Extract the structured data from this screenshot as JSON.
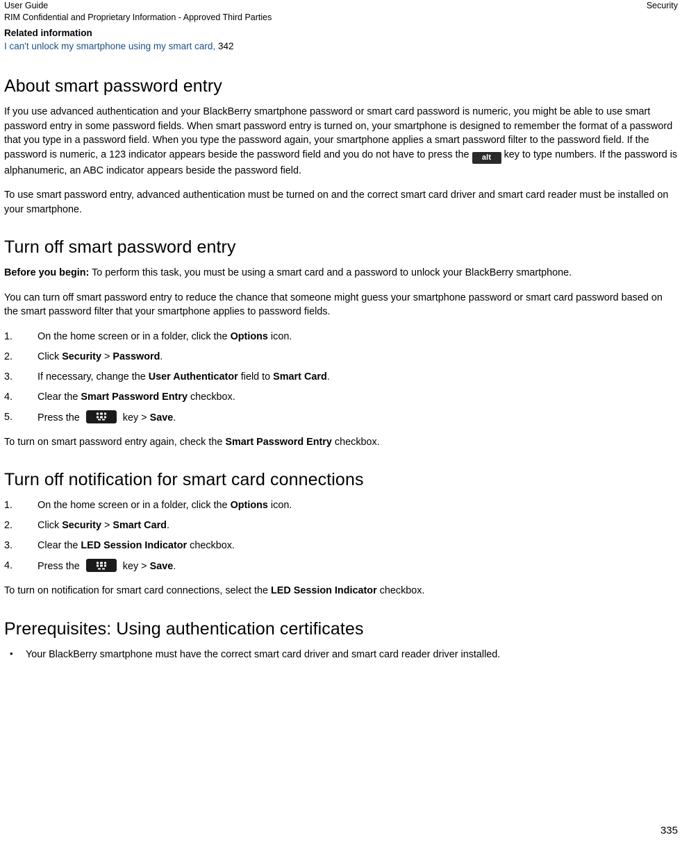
{
  "header": {
    "left_line1": "User Guide",
    "left_line2": "RIM Confidential and Proprietary Information - Approved Third Parties",
    "right_line1": "Security"
  },
  "related": {
    "title": "Related information",
    "link_text": "I can't unlock my smartphone using my smart card,",
    "page_ref": " 342"
  },
  "sections": {
    "smart_password_entry": {
      "heading": "About smart password entry",
      "para1_a": "If you use advanced authentication and your BlackBerry smartphone password or smart card password is numeric, you might be able to use smart password entry in some password fields. When smart password entry is turned on, your smartphone is designed to remember the format of a password that you type in a password field. When you type the password again, your smartphone applies a smart password filter to the password field. If the password is numeric, a 123 indicator appears beside the password field and you do not have to press the",
      "alt_key": "alt",
      "para1_b": "key to type numbers. If the password is alphanumeric, an ABC indicator appears beside the password field.",
      "para2": "To use smart password entry, advanced authentication must be turned on and the correct smart card driver and smart card reader must be installed on your smartphone."
    },
    "turn_off_smart_password": {
      "heading": "Turn off smart password entry",
      "before_label": "Before you begin:",
      "before_text": " To perform this task, you must be using a smart card and a password to unlock your BlackBerry smartphone.",
      "para": "You can turn off smart password entry to reduce the chance that someone might guess your smartphone password or smart card password based on the smart password filter that your smartphone applies to password fields.",
      "steps": [
        {
          "num": "1.",
          "parts": [
            {
              "t": "On the home screen or in a folder, click the ",
              "b": false
            },
            {
              "t": "Options",
              "b": true
            },
            {
              "t": " icon.",
              "b": false
            }
          ]
        },
        {
          "num": "2.",
          "parts": [
            {
              "t": "Click ",
              "b": false
            },
            {
              "t": "Security",
              "b": true
            },
            {
              "t": " > ",
              "b": false
            },
            {
              "t": "Password",
              "b": true
            },
            {
              "t": ".",
              "b": false
            }
          ]
        },
        {
          "num": "3.",
          "parts": [
            {
              "t": "If necessary, change the ",
              "b": false
            },
            {
              "t": "User Authenticator",
              "b": true
            },
            {
              "t": " field to ",
              "b": false
            },
            {
              "t": "Smart Card",
              "b": true
            },
            {
              "t": ".",
              "b": false
            }
          ]
        },
        {
          "num": "4.",
          "parts": [
            {
              "t": "Clear the ",
              "b": false
            },
            {
              "t": "Smart Password Entry",
              "b": true
            },
            {
              "t": " checkbox.",
              "b": false
            }
          ]
        },
        {
          "num": "5.",
          "key": "menu-key",
          "parts": [
            {
              "t": "Press the ",
              "b": false
            }
          ],
          "after": [
            {
              "t": " key > ",
              "b": false
            },
            {
              "t": "Save",
              "b": true
            },
            {
              "t": ".",
              "b": false
            }
          ]
        }
      ],
      "after_steps_parts": [
        {
          "t": "To turn on smart password entry again, check the ",
          "b": false
        },
        {
          "t": "Smart Password Entry",
          "b": true
        },
        {
          "t": " checkbox.",
          "b": false
        }
      ]
    },
    "turn_off_notification": {
      "heading": "Turn off notification for smart card connections",
      "steps": [
        {
          "num": "1.",
          "parts": [
            {
              "t": "On the home screen or in a folder, click the ",
              "b": false
            },
            {
              "t": "Options",
              "b": true
            },
            {
              "t": " icon.",
              "b": false
            }
          ]
        },
        {
          "num": "2.",
          "parts": [
            {
              "t": "Click ",
              "b": false
            },
            {
              "t": "Security",
              "b": true
            },
            {
              "t": " > ",
              "b": false
            },
            {
              "t": "Smart Card",
              "b": true
            },
            {
              "t": ".",
              "b": false
            }
          ]
        },
        {
          "num": "3.",
          "parts": [
            {
              "t": "Clear the ",
              "b": false
            },
            {
              "t": "LED Session Indicator",
              "b": true
            },
            {
              "t": " checkbox.",
              "b": false
            }
          ]
        },
        {
          "num": "4.",
          "key": "menu-key",
          "parts": [
            {
              "t": "Press the ",
              "b": false
            }
          ],
          "after": [
            {
              "t": " key > ",
              "b": false
            },
            {
              "t": "Save",
              "b": true
            },
            {
              "t": ".",
              "b": false
            }
          ]
        }
      ],
      "after_steps_parts": [
        {
          "t": "To turn on notification for smart card connections, select the ",
          "b": false
        },
        {
          "t": "LED Session Indicator",
          "b": true
        },
        {
          "t": " checkbox.",
          "b": false
        }
      ]
    },
    "prerequisites": {
      "heading": "Prerequisites: Using authentication certificates",
      "bullets": [
        "Your BlackBerry smartphone must have the correct smart card driver and smart card reader driver installed."
      ]
    }
  },
  "footer": {
    "page_number": "335"
  },
  "colors": {
    "link": "#1a4f87",
    "key_background": "#1b1b1b"
  }
}
